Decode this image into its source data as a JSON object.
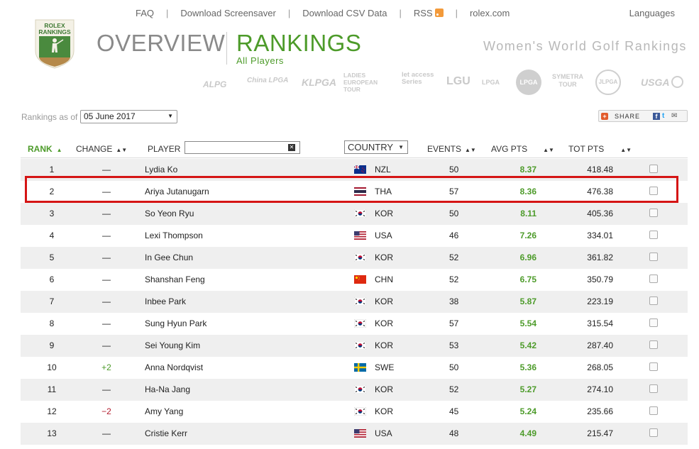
{
  "nav": {
    "links": [
      "FAQ",
      "Download Screensaver",
      "Download CSV Data",
      "RSS",
      "rolex.com"
    ],
    "languages": "Languages"
  },
  "logo": {
    "line1": "ROLEX",
    "line2": "RANKINGS"
  },
  "header": {
    "overview": "OVERVIEW",
    "rankings": "RANKINGS",
    "subtitle": "All Players",
    "site_title": "Women's World Golf Rankings"
  },
  "tours": [
    "ALPG",
    "China LPGA",
    "KLPGA",
    "LADIES EUROPEAN TOUR",
    "let access Series",
    "LGU",
    "LPGA",
    "LPGA",
    "SYMETRA TOUR",
    "JLPGA",
    "USGA"
  ],
  "controls": {
    "asof_label": "Rankings as of",
    "date_value": "05 June 2017",
    "share_label": "SHARE"
  },
  "columns": {
    "rank": "RANK",
    "change": "CHANGE",
    "player": "PLAYER",
    "country": "COUNTRY",
    "events": "EVENTS",
    "avg": "AVG PTS",
    "tot": "TOT PTS"
  },
  "rows": [
    {
      "rank": "1",
      "change": "—",
      "player": "Lydia Ko",
      "flag": "nzl",
      "country": "NZL",
      "events": "50",
      "avg": "8.37",
      "tot": "418.48"
    },
    {
      "rank": "2",
      "change": "—",
      "player": "Ariya Jutanugarn",
      "flag": "tha",
      "country": "THA",
      "events": "57",
      "avg": "8.36",
      "tot": "476.38"
    },
    {
      "rank": "3",
      "change": "—",
      "player": "So Yeon Ryu",
      "flag": "kor",
      "country": "KOR",
      "events": "50",
      "avg": "8.11",
      "tot": "405.36"
    },
    {
      "rank": "4",
      "change": "—",
      "player": "Lexi Thompson",
      "flag": "usa",
      "country": "USA",
      "events": "46",
      "avg": "7.26",
      "tot": "334.01"
    },
    {
      "rank": "5",
      "change": "—",
      "player": "In Gee Chun",
      "flag": "kor",
      "country": "KOR",
      "events": "52",
      "avg": "6.96",
      "tot": "361.82"
    },
    {
      "rank": "6",
      "change": "—",
      "player": "Shanshan Feng",
      "flag": "chn",
      "country": "CHN",
      "events": "52",
      "avg": "6.75",
      "tot": "350.79"
    },
    {
      "rank": "7",
      "change": "—",
      "player": "Inbee Park",
      "flag": "kor",
      "country": "KOR",
      "events": "38",
      "avg": "5.87",
      "tot": "223.19"
    },
    {
      "rank": "8",
      "change": "—",
      "player": "Sung Hyun Park",
      "flag": "kor",
      "country": "KOR",
      "events": "57",
      "avg": "5.54",
      "tot": "315.54"
    },
    {
      "rank": "9",
      "change": "—",
      "player": "Sei Young Kim",
      "flag": "kor",
      "country": "KOR",
      "events": "53",
      "avg": "5.42",
      "tot": "287.40"
    },
    {
      "rank": "10",
      "change": "+2",
      "player": "Anna Nordqvist",
      "flag": "swe",
      "country": "SWE",
      "events": "50",
      "avg": "5.36",
      "tot": "268.05"
    },
    {
      "rank": "11",
      "change": "—",
      "player": "Ha-Na Jang",
      "flag": "kor",
      "country": "KOR",
      "events": "52",
      "avg": "5.27",
      "tot": "274.10"
    },
    {
      "rank": "12",
      "change": "−2",
      "player": "Amy Yang",
      "flag": "kor",
      "country": "KOR",
      "events": "45",
      "avg": "5.24",
      "tot": "235.66"
    },
    {
      "rank": "13",
      "change": "—",
      "player": "Cristie Kerr",
      "flag": "usa",
      "country": "USA",
      "events": "48",
      "avg": "4.49",
      "tot": "215.47"
    }
  ],
  "colors": {
    "accent_green": "#4d9b2a",
    "highlight_red": "#d51515",
    "negative": "#b21b2d"
  }
}
